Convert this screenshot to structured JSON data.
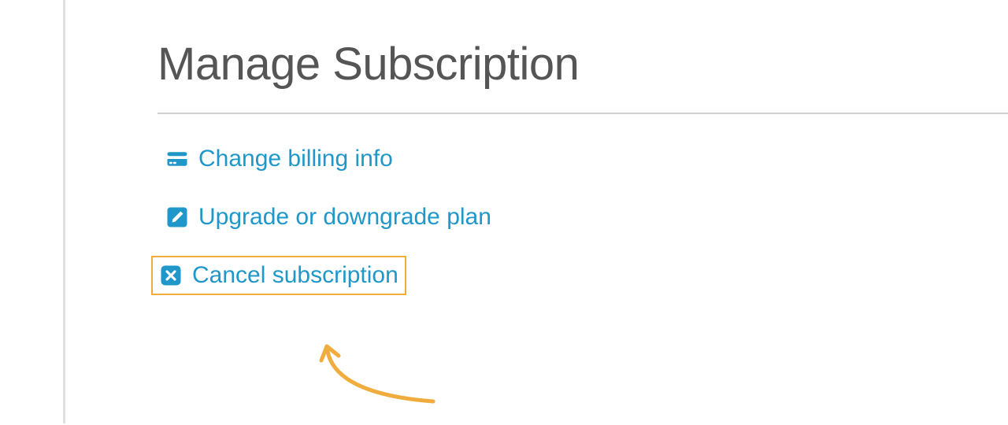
{
  "page": {
    "title": "Manage Subscription"
  },
  "actions": {
    "billing": {
      "label": "Change billing info",
      "icon": "credit-card-icon"
    },
    "plan": {
      "label": "Upgrade or downgrade plan",
      "icon": "edit-icon"
    },
    "cancel": {
      "label": "Cancel subscription",
      "icon": "x-box-icon",
      "highlighted": true
    }
  },
  "colors": {
    "accent": "#1f97c9",
    "title": "#555555",
    "highlight_border": "#f0ad3e",
    "annotation": "#f0ad3e"
  }
}
